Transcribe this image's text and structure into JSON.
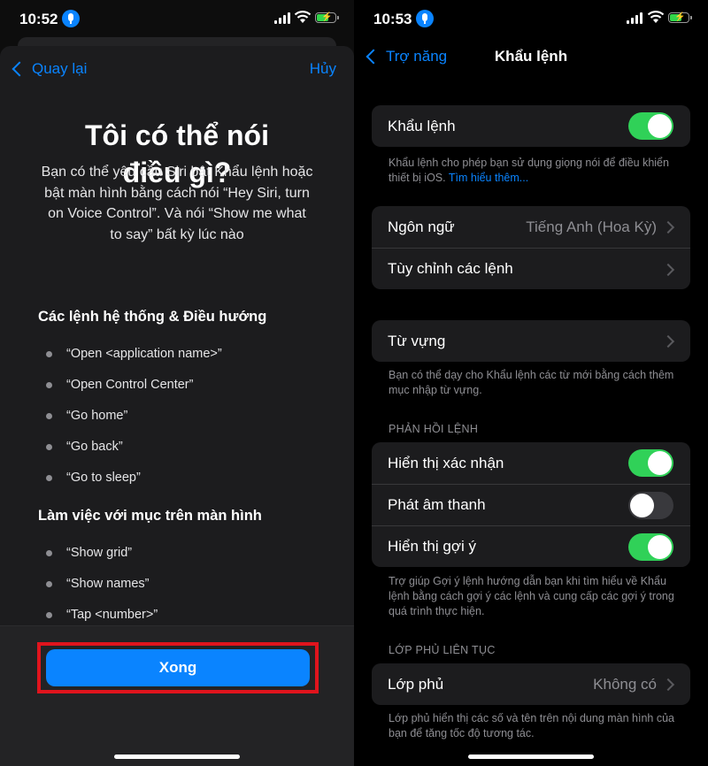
{
  "left_screen": {
    "status": {
      "time": "10:52"
    },
    "nav": {
      "back_label": "Quay lại",
      "cancel_label": "Hủy"
    },
    "title_line1": "Tôi có thể nói",
    "title_line2": "điều gì?",
    "description_lines": [
      "Bạn có thể yêu cầu Siri bật Khẩu lệnh hoặc",
      "bật màn hình bằng cách nói “Hey Siri, turn",
      "on Voice Control”. Và nói “Show me what",
      "to say” bất kỳ lúc nào"
    ],
    "sections": [
      {
        "heading": "Các lệnh hệ thống & Điều hướng",
        "commands": [
          "“Open <application name>”",
          "“Open Control Center”",
          "“Go home”",
          "“Go back”",
          "“Go to sleep”"
        ]
      },
      {
        "heading": "Làm việc với mục trên màn hình",
        "commands": [
          "“Show grid”",
          "“Show names”",
          "“Tap <number>”"
        ]
      }
    ],
    "done_label": "Xong"
  },
  "right_screen": {
    "status": {
      "time": "10:53"
    },
    "nav": {
      "back_label": "Trợ năng",
      "title": "Khẩu lệnh"
    },
    "voice_control": {
      "label": "Khẩu lệnh",
      "enabled": true
    },
    "voice_control_footnote": "Khẩu lệnh cho phép bạn sử dụng giọng nói để điều khiển thiết bị iOS.",
    "learn_more_label": "Tìm hiểu thêm...",
    "language": {
      "label": "Ngôn ngữ",
      "value": "Tiếng Anh (Hoa Kỳ)"
    },
    "customize_label": "Tùy chỉnh các lệnh",
    "vocabulary": {
      "label": "Từ vựng",
      "footnote": "Bạn có thể dạy cho Khẩu lệnh các từ mới bằng cách thêm mục nhập từ vựng."
    },
    "command_feedback": {
      "header": "PHẢN HỒI LỆNH",
      "show_confirmation": {
        "label": "Hiển thị xác nhận",
        "enabled": true
      },
      "play_sound": {
        "label": "Phát âm thanh",
        "enabled": false
      },
      "show_hints": {
        "label": "Hiển thị gợi ý",
        "enabled": true
      },
      "footnote": "Trợ giúp Gợi ý lệnh hướng dẫn bạn khi tìm hiểu về Khẩu lệnh bằng cách gợi ý các lệnh và cung cấp các gợi ý trong quá trình thực hiện."
    },
    "continuous_overlay": {
      "header": "LỚP PHỦ LIÊN TỤC",
      "overlay": {
        "label": "Lớp phủ",
        "value": "Không có"
      },
      "footnote": "Lớp phủ hiển thị các số và tên trên nội dung màn hình của bạn để tăng tốc độ tương tác."
    }
  },
  "colors": {
    "accent": "#0a84ff",
    "toggle_on": "#30d158",
    "highlight": "#e0141d"
  }
}
